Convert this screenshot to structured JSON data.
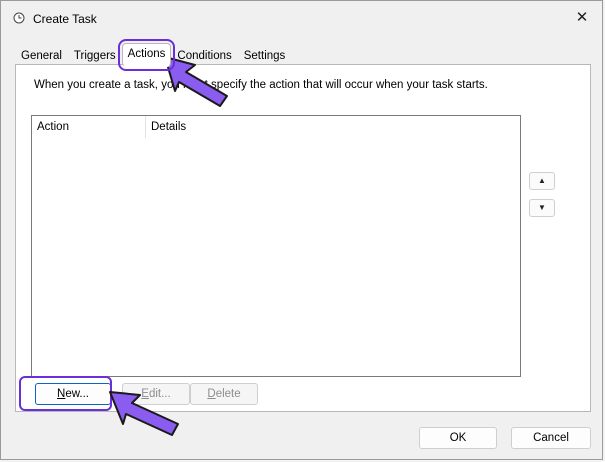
{
  "window": {
    "title": "Create Task",
    "icon": "clock-icon",
    "close_glyph": "✕"
  },
  "tabs": [
    {
      "label": "General",
      "active": false
    },
    {
      "label": "Triggers",
      "active": false
    },
    {
      "label": "Actions",
      "active": true
    },
    {
      "label": "Conditions",
      "active": false
    },
    {
      "label": "Settings",
      "active": false
    }
  ],
  "actions_tab": {
    "intro_text": "When you create a task, you must specify the action that will occur when your task starts.",
    "list_columns": [
      "Action",
      "Details"
    ],
    "move_up_glyph": "▲",
    "move_down_glyph": "▼",
    "buttons": {
      "new_label_prefix": "N",
      "new_label_rest": "ew...",
      "edit_label_prefix": "E",
      "edit_label_rest": "dit...",
      "delete_label_prefix": "D",
      "delete_label_rest": "elete"
    }
  },
  "footer": {
    "ok_label": "OK",
    "cancel_label": "Cancel"
  },
  "annotations": {
    "highlight_color": "#6a2fd8",
    "arrow_fill": "#8a5cf0"
  }
}
